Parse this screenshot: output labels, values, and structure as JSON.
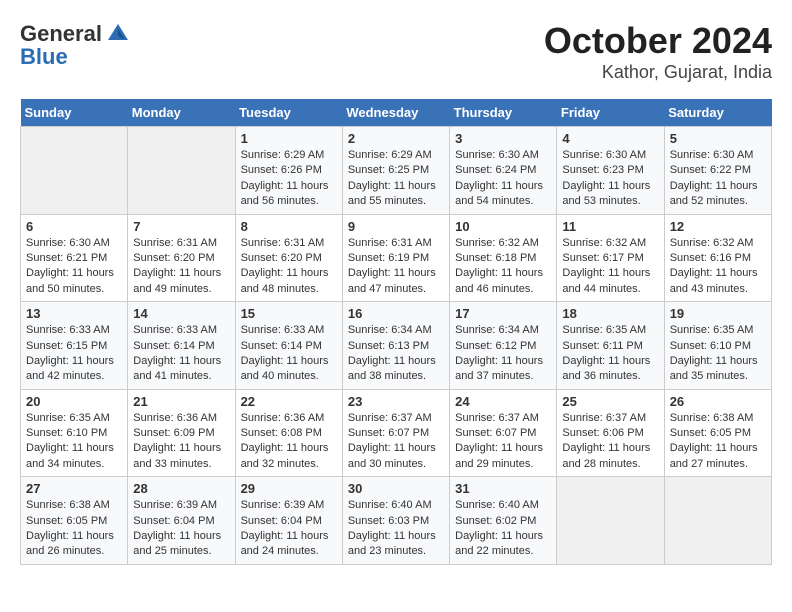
{
  "header": {
    "logo_general": "General",
    "logo_blue": "Blue",
    "title": "October 2024",
    "subtitle": "Kathor, Gujarat, India"
  },
  "weekdays": [
    "Sunday",
    "Monday",
    "Tuesday",
    "Wednesday",
    "Thursday",
    "Friday",
    "Saturday"
  ],
  "weeks": [
    [
      {
        "day": "",
        "sunrise": "",
        "sunset": "",
        "daylight": ""
      },
      {
        "day": "",
        "sunrise": "",
        "sunset": "",
        "daylight": ""
      },
      {
        "day": "1",
        "sunrise": "Sunrise: 6:29 AM",
        "sunset": "Sunset: 6:26 PM",
        "daylight": "Daylight: 11 hours and 56 minutes."
      },
      {
        "day": "2",
        "sunrise": "Sunrise: 6:29 AM",
        "sunset": "Sunset: 6:25 PM",
        "daylight": "Daylight: 11 hours and 55 minutes."
      },
      {
        "day": "3",
        "sunrise": "Sunrise: 6:30 AM",
        "sunset": "Sunset: 6:24 PM",
        "daylight": "Daylight: 11 hours and 54 minutes."
      },
      {
        "day": "4",
        "sunrise": "Sunrise: 6:30 AM",
        "sunset": "Sunset: 6:23 PM",
        "daylight": "Daylight: 11 hours and 53 minutes."
      },
      {
        "day": "5",
        "sunrise": "Sunrise: 6:30 AM",
        "sunset": "Sunset: 6:22 PM",
        "daylight": "Daylight: 11 hours and 52 minutes."
      }
    ],
    [
      {
        "day": "6",
        "sunrise": "Sunrise: 6:30 AM",
        "sunset": "Sunset: 6:21 PM",
        "daylight": "Daylight: 11 hours and 50 minutes."
      },
      {
        "day": "7",
        "sunrise": "Sunrise: 6:31 AM",
        "sunset": "Sunset: 6:20 PM",
        "daylight": "Daylight: 11 hours and 49 minutes."
      },
      {
        "day": "8",
        "sunrise": "Sunrise: 6:31 AM",
        "sunset": "Sunset: 6:20 PM",
        "daylight": "Daylight: 11 hours and 48 minutes."
      },
      {
        "day": "9",
        "sunrise": "Sunrise: 6:31 AM",
        "sunset": "Sunset: 6:19 PM",
        "daylight": "Daylight: 11 hours and 47 minutes."
      },
      {
        "day": "10",
        "sunrise": "Sunrise: 6:32 AM",
        "sunset": "Sunset: 6:18 PM",
        "daylight": "Daylight: 11 hours and 46 minutes."
      },
      {
        "day": "11",
        "sunrise": "Sunrise: 6:32 AM",
        "sunset": "Sunset: 6:17 PM",
        "daylight": "Daylight: 11 hours and 44 minutes."
      },
      {
        "day": "12",
        "sunrise": "Sunrise: 6:32 AM",
        "sunset": "Sunset: 6:16 PM",
        "daylight": "Daylight: 11 hours and 43 minutes."
      }
    ],
    [
      {
        "day": "13",
        "sunrise": "Sunrise: 6:33 AM",
        "sunset": "Sunset: 6:15 PM",
        "daylight": "Daylight: 11 hours and 42 minutes."
      },
      {
        "day": "14",
        "sunrise": "Sunrise: 6:33 AM",
        "sunset": "Sunset: 6:14 PM",
        "daylight": "Daylight: 11 hours and 41 minutes."
      },
      {
        "day": "15",
        "sunrise": "Sunrise: 6:33 AM",
        "sunset": "Sunset: 6:14 PM",
        "daylight": "Daylight: 11 hours and 40 minutes."
      },
      {
        "day": "16",
        "sunrise": "Sunrise: 6:34 AM",
        "sunset": "Sunset: 6:13 PM",
        "daylight": "Daylight: 11 hours and 38 minutes."
      },
      {
        "day": "17",
        "sunrise": "Sunrise: 6:34 AM",
        "sunset": "Sunset: 6:12 PM",
        "daylight": "Daylight: 11 hours and 37 minutes."
      },
      {
        "day": "18",
        "sunrise": "Sunrise: 6:35 AM",
        "sunset": "Sunset: 6:11 PM",
        "daylight": "Daylight: 11 hours and 36 minutes."
      },
      {
        "day": "19",
        "sunrise": "Sunrise: 6:35 AM",
        "sunset": "Sunset: 6:10 PM",
        "daylight": "Daylight: 11 hours and 35 minutes."
      }
    ],
    [
      {
        "day": "20",
        "sunrise": "Sunrise: 6:35 AM",
        "sunset": "Sunset: 6:10 PM",
        "daylight": "Daylight: 11 hours and 34 minutes."
      },
      {
        "day": "21",
        "sunrise": "Sunrise: 6:36 AM",
        "sunset": "Sunset: 6:09 PM",
        "daylight": "Daylight: 11 hours and 33 minutes."
      },
      {
        "day": "22",
        "sunrise": "Sunrise: 6:36 AM",
        "sunset": "Sunset: 6:08 PM",
        "daylight": "Daylight: 11 hours and 32 minutes."
      },
      {
        "day": "23",
        "sunrise": "Sunrise: 6:37 AM",
        "sunset": "Sunset: 6:07 PM",
        "daylight": "Daylight: 11 hours and 30 minutes."
      },
      {
        "day": "24",
        "sunrise": "Sunrise: 6:37 AM",
        "sunset": "Sunset: 6:07 PM",
        "daylight": "Daylight: 11 hours and 29 minutes."
      },
      {
        "day": "25",
        "sunrise": "Sunrise: 6:37 AM",
        "sunset": "Sunset: 6:06 PM",
        "daylight": "Daylight: 11 hours and 28 minutes."
      },
      {
        "day": "26",
        "sunrise": "Sunrise: 6:38 AM",
        "sunset": "Sunset: 6:05 PM",
        "daylight": "Daylight: 11 hours and 27 minutes."
      }
    ],
    [
      {
        "day": "27",
        "sunrise": "Sunrise: 6:38 AM",
        "sunset": "Sunset: 6:05 PM",
        "daylight": "Daylight: 11 hours and 26 minutes."
      },
      {
        "day": "28",
        "sunrise": "Sunrise: 6:39 AM",
        "sunset": "Sunset: 6:04 PM",
        "daylight": "Daylight: 11 hours and 25 minutes."
      },
      {
        "day": "29",
        "sunrise": "Sunrise: 6:39 AM",
        "sunset": "Sunset: 6:04 PM",
        "daylight": "Daylight: 11 hours and 24 minutes."
      },
      {
        "day": "30",
        "sunrise": "Sunrise: 6:40 AM",
        "sunset": "Sunset: 6:03 PM",
        "daylight": "Daylight: 11 hours and 23 minutes."
      },
      {
        "day": "31",
        "sunrise": "Sunrise: 6:40 AM",
        "sunset": "Sunset: 6:02 PM",
        "daylight": "Daylight: 11 hours and 22 minutes."
      },
      {
        "day": "",
        "sunrise": "",
        "sunset": "",
        "daylight": ""
      },
      {
        "day": "",
        "sunrise": "",
        "sunset": "",
        "daylight": ""
      }
    ]
  ]
}
